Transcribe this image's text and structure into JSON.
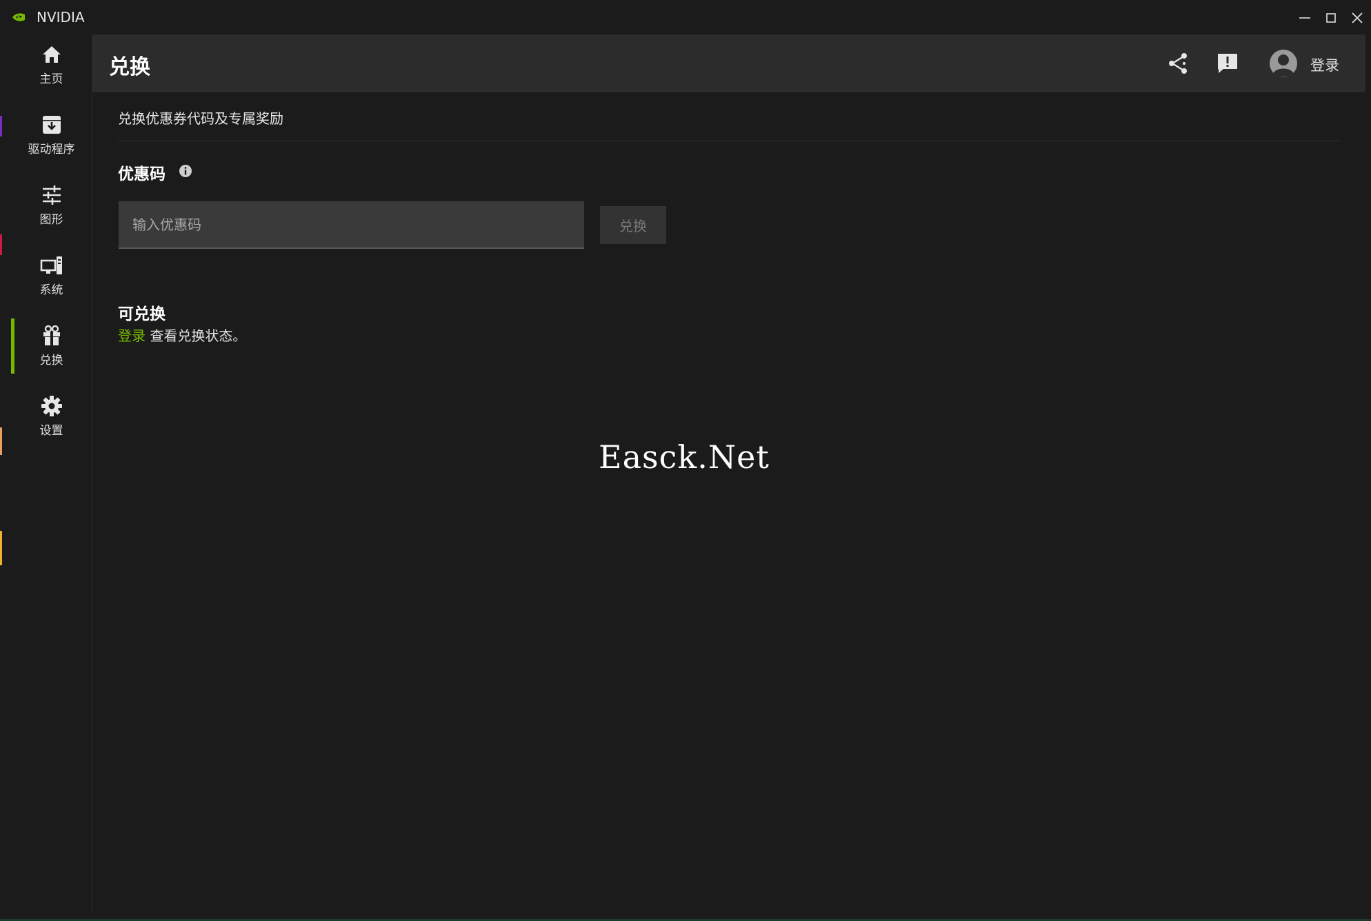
{
  "window": {
    "app_title": "NVIDIA",
    "controls": [
      "minimize-icon",
      "maximize-icon",
      "close-icon"
    ]
  },
  "sidebar": {
    "items": [
      {
        "label": "主页",
        "icon": "home-icon"
      },
      {
        "label": "驱动程序",
        "icon": "driver-download-icon"
      },
      {
        "label": "图形",
        "icon": "sliders-icon"
      },
      {
        "label": "系统",
        "icon": "system-monitor-icon"
      },
      {
        "label": "兑换",
        "icon": "gift-icon",
        "active": true
      },
      {
        "label": "设置",
        "icon": "gear-icon"
      }
    ]
  },
  "header": {
    "title": "兑换",
    "login_label": "登录",
    "icons": [
      "share-icon",
      "feedback-icon",
      "avatar-icon"
    ]
  },
  "content": {
    "subtitle": "兑换优惠券代码及专属奖励",
    "code_section": {
      "title": "优惠码",
      "input_placeholder": "输入优惠码",
      "input_value": "",
      "redeem_label": "兑换"
    },
    "available": {
      "title": "可兑换",
      "login_link": "登录",
      "status_text": " 查看兑换状态。"
    },
    "watermark": "Easck.Net"
  },
  "colors": {
    "accent": "#76b900",
    "background": "#1b1b1b",
    "header_bg": "#2c2c2c",
    "input_bg": "#3a3a3a"
  }
}
